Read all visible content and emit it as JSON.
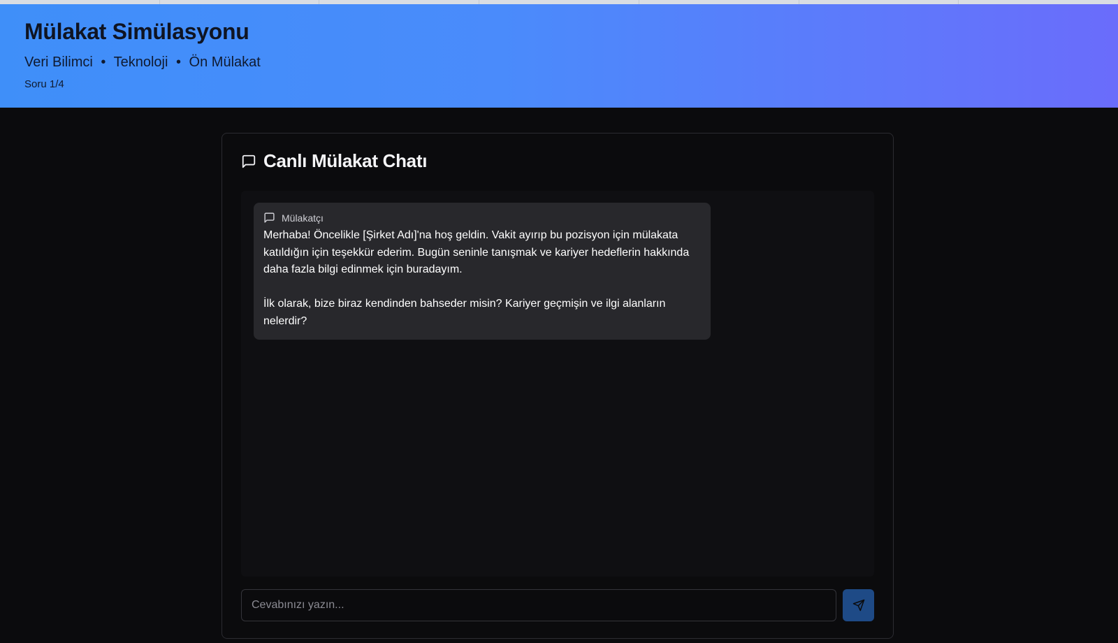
{
  "progress": {
    "current_question": 1,
    "total_questions": 4
  },
  "header": {
    "title": "Mülakat Simülasyonu",
    "role": "Veri Bilimci",
    "separator": "•",
    "field": "Teknoloji",
    "stage": "Ön Mülakat",
    "question_counter": "Soru 1/4"
  },
  "chat": {
    "title": "Canlı Mülakat Chatı",
    "title_icon": "message-square-icon",
    "messages": [
      {
        "author": "Mülakatçı",
        "author_icon": "message-square-icon",
        "paragraph_1": "Merhaba! Öncelikle [Şirket Adı]'na hoş geldin. Vakit ayırıp bu pozisyon için mülakata katıldığın için teşekkür ederim. Bugün seninle tanışmak ve kariyer hedeflerin hakkında daha fazla bilgi edinmek için buradayım.",
        "paragraph_2": "İlk olarak, bize biraz kendinden bahseder misin? Kariyer geçmişin ve ilgi alanların nelerdir?"
      }
    ],
    "input": {
      "value": "",
      "placeholder": "Cevabınızı yazın..."
    },
    "send_icon": "send-icon"
  },
  "colors": {
    "header_gradient_start": "#3f8ff9",
    "header_gradient_end": "#6a6cfb",
    "background": "#0b0b0d",
    "bubble": "#28282c",
    "send_button": "#1e4a86"
  }
}
